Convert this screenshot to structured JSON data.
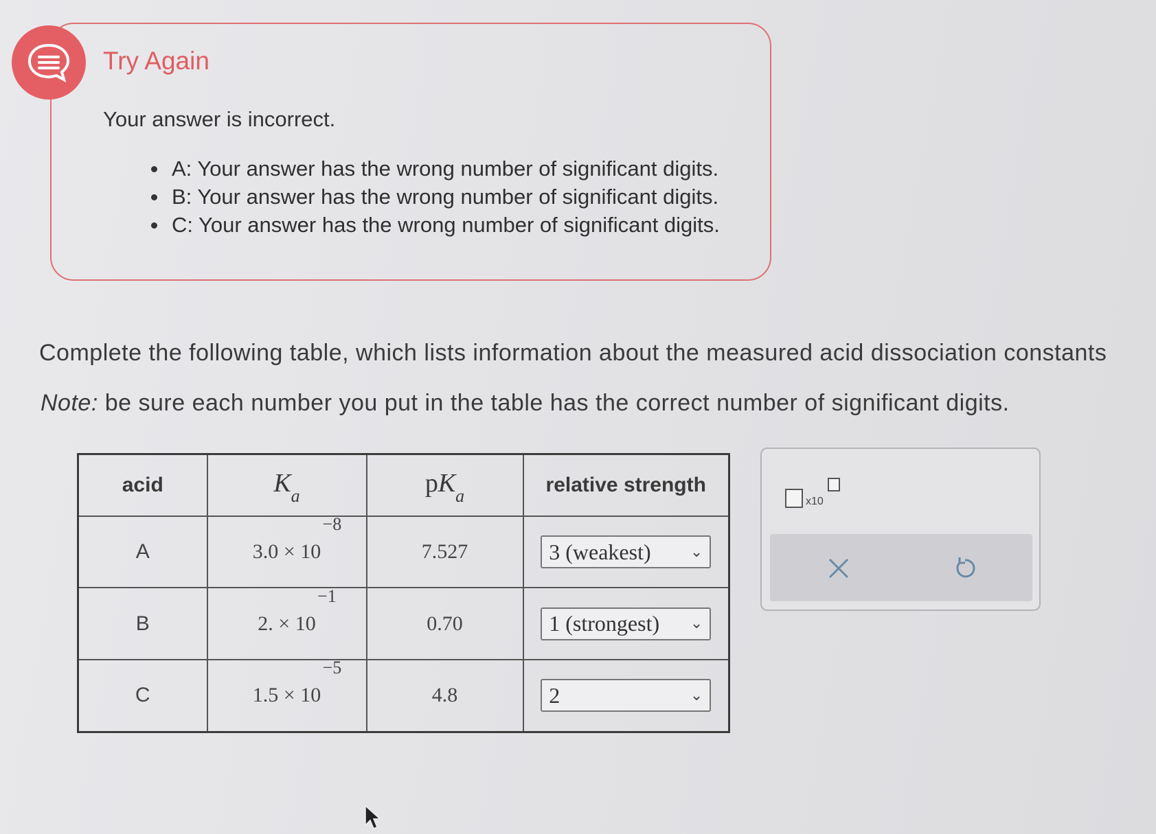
{
  "feedback": {
    "title": "Try Again",
    "message": "Your answer is incorrect.",
    "items": [
      "A: Your answer has the wrong number of significant digits.",
      "B: Your answer has the wrong number of significant digits.",
      "C: Your answer has the wrong number of significant digits."
    ],
    "icon": "chat-bubble-icon",
    "color": "#df5d62"
  },
  "instructions": "Complete the following table, which lists information about the measured acid dissociation constants",
  "note": {
    "label": "Note:",
    "text": " be sure each number you put in the table has the correct number of significant digits."
  },
  "table": {
    "headers": {
      "acid": "acid",
      "ka": "K",
      "ka_sub": "a",
      "pka_prefix": "p",
      "pka": "K",
      "pka_sub": "a",
      "strength": "relative strength"
    },
    "rows": [
      {
        "acid": "A",
        "ka_mantissa": "3.0 × 10",
        "ka_exp": "−8",
        "pka": "7.527",
        "strength": "3 (weakest)"
      },
      {
        "acid": "B",
        "ka_mantissa": "2. × 10",
        "ka_exp": "−1",
        "pka": "0.70",
        "strength": "1 (strongest)"
      },
      {
        "acid": "C",
        "ka_mantissa": "1.5 × 10",
        "ka_exp": "−5",
        "pka": "4.8",
        "strength": "2"
      }
    ]
  },
  "tool": {
    "x10_label": "x10",
    "icons": [
      "scientific-notation-icon",
      "close-icon",
      "undo-icon"
    ]
  }
}
